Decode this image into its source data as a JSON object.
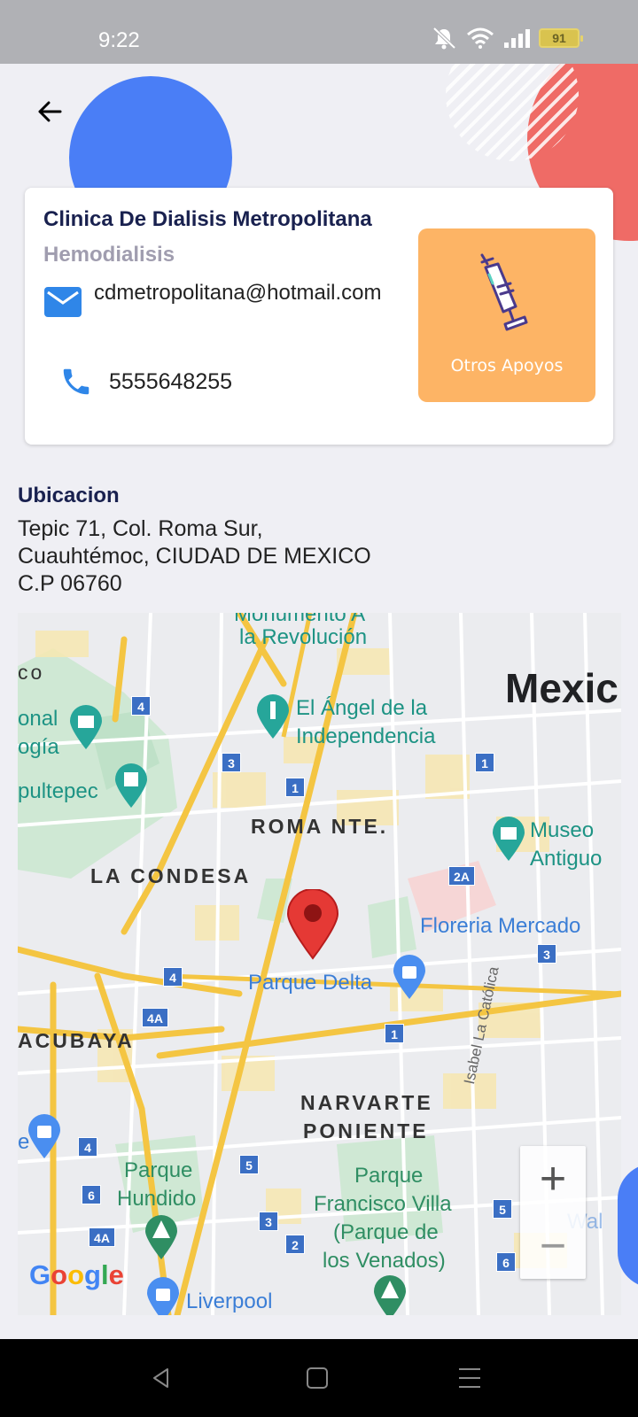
{
  "status_bar": {
    "time": "9:22",
    "battery": "91",
    "icons": [
      "mute-icon",
      "wifi-icon",
      "signal-icon",
      "battery-icon"
    ]
  },
  "header": {
    "back_icon": "arrow-left-icon"
  },
  "clinic": {
    "name": "Clinica De Dialisis Metropolitana",
    "service": "Hemodialisis",
    "email": "cdmetropolitana@hotmail.com",
    "phone": "5555648255",
    "email_icon": "mail-icon",
    "phone_icon": "phone-icon"
  },
  "otros_apoyos": {
    "label": "Otros Apoyos",
    "icon": "syringe-icon"
  },
  "location": {
    "title": "Ubicacion",
    "line1": "Tepic 71, Col. Roma Sur,",
    "line2": "Cuauhtémoc, CIUDAD DE MEXICO",
    "line3": "C.P 06760"
  },
  "map": {
    "labels": {
      "monumento": "Monumento A",
      "revolucion": "la Revolución",
      "co": "co",
      "mexico": "Mexic",
      "onal": "onal",
      "ogia": "ogía",
      "angel1": "El Ángel de la",
      "angel2": "Independencia",
      "chapultepec": "pultepec",
      "roma_nte": "ROMA NTE.",
      "museo1": "Museo",
      "museo2": "Antiguo",
      "condesa": "LA CONDESA",
      "floreria": "Floreria Mercado",
      "parque_delta": "Parque Delta",
      "tacubaya": "ACUBAYA",
      "narvarte1": "NARVARTE",
      "narvarte2": "PONIENTE",
      "isabel": "Isabel La Católica",
      "parque_hundido1": "Parque",
      "parque_hundido2": "Hundido",
      "villa1": "Parque",
      "villa2": "Francisco Villa",
      "villa3": "(Parque de",
      "villa4": "los Venados)",
      "wal": "Wal",
      "liverpool": "Liverpool",
      "e": "e"
    },
    "shields": [
      "4",
      "3",
      "1",
      "1",
      "2A",
      "3",
      "4",
      "4A",
      "1",
      "4",
      "6",
      "5",
      "5",
      "3",
      "2",
      "4A",
      "6"
    ],
    "zoom_in": "+",
    "zoom_out": "−",
    "google": "Google",
    "marker": "map-pin-icon"
  },
  "nav_bar": {
    "back": "nav-back-icon",
    "home": "nav-home-icon",
    "menu": "nav-menu-icon"
  },
  "colors": {
    "accent_blue": "#4a7ef6",
    "accent_red": "#ef6b66",
    "otros_orange": "#fdb465",
    "title_navy": "#19214f",
    "service_gray": "#a09daf",
    "icon_blue": "#2f86e8"
  }
}
